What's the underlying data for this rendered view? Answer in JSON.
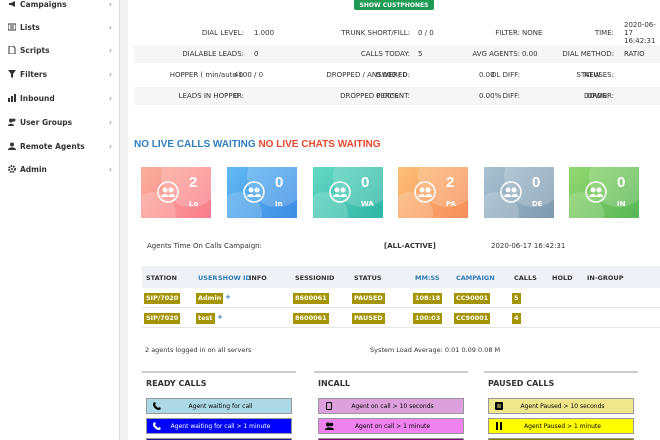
{
  "sidebar": {
    "items": [
      {
        "label": "Campaigns",
        "icon": "megaphone-icon"
      },
      {
        "label": "Lists",
        "icon": "list-icon"
      },
      {
        "label": "Scripts",
        "icon": "document-icon"
      },
      {
        "label": "Filters",
        "icon": "filter-icon"
      },
      {
        "label": "Inbound",
        "icon": "bar-chart-icon"
      },
      {
        "label": "User Groups",
        "icon": "users-icon"
      },
      {
        "label": "Remote Agents",
        "icon": "remote-agents-icon"
      },
      {
        "label": "Admin",
        "icon": "gear-icon"
      }
    ],
    "chevron": "‹"
  },
  "top_button": "SHOW CUSTPHONES",
  "stats": [
    [
      [
        "DIAL LEVEL:",
        "1.000"
      ],
      [
        "TRUNK SHORT/FILL:",
        "0 / 0"
      ],
      [
        "FILTER:",
        "NONE"
      ],
      [
        "TIME:",
        "2020-06-17 16:42:31"
      ]
    ],
    [
      [
        "DIALABLE LEADS:",
        "0"
      ],
      [
        "CALLS TODAY:",
        "5"
      ],
      [
        "AVG AGENTS:",
        "0.00"
      ],
      [
        "DIAL METHOD:",
        "RATIO"
      ]
    ],
    [
      [
        "HOPPER ( min/auto ):",
        "4000 / 0"
      ],
      [
        "DROPPED / ANSWERED:",
        "0.000 / 0"
      ],
      [
        "DL DIFF:",
        "0.00"
      ],
      [
        "STATUSES:",
        "NEW"
      ]
    ],
    [
      [
        "LEADS IN HOPPER:",
        "0"
      ],
      [
        "DROPPED PERCENT:",
        "0.00%"
      ],
      [
        "DIFF:",
        "0.00%"
      ],
      [
        "ORDER:",
        "DOWN"
      ]
    ]
  ],
  "waiting": {
    "calls": "NO LIVE CALLS WAITING",
    "chats": "NO LIVE CHATS WAITING",
    "calls_color": "#2f7ebd",
    "chats_color": "#e8492f"
  },
  "cards": [
    {
      "num": "2",
      "label": "Lo",
      "colors": [
        "#f7a39a",
        "#fc7a8e"
      ]
    },
    {
      "num": "0",
      "label": "In",
      "colors": [
        "#5fb6f0",
        "#3f8ee6"
      ]
    },
    {
      "num": "0",
      "label": "WA",
      "colors": [
        "#5fd5c0",
        "#2fb7a6"
      ]
    },
    {
      "num": "2",
      "label": "PA",
      "colors": [
        "#fbbd76",
        "#f7905c"
      ]
    },
    {
      "num": "0",
      "label": "DE",
      "colors": [
        "#a7c0d0",
        "#7f9bb0"
      ]
    },
    {
      "num": "0",
      "label": "IN",
      "colors": [
        "#8fd56c",
        "#5bb85a"
      ]
    }
  ],
  "agents_line": {
    "label": "Agents Time On Calls Campaign:",
    "campaign": "[ALL-ACTIVE]",
    "time": "2020-06-17 16:42:31"
  },
  "table": {
    "headers": {
      "station": "STATION",
      "user": "USER",
      "show_id": "SHOW ID",
      "info": "INFO",
      "session": "SESSIONID",
      "status": "STATUS",
      "mmss": "MM:SS",
      "campaign": "CAMPAIGN",
      "calls": "CALLS",
      "hold": "HOLD",
      "ingroup": "IN-GROUP"
    },
    "rows": [
      {
        "station": "SIP/7020",
        "user": "Admin",
        "plus": "+",
        "session": "8600061",
        "status": "PAUSED",
        "mmss": "108:18",
        "campaign": "CC90001",
        "calls": "5"
      },
      {
        "station": "SIP/7020",
        "user": "test",
        "plus": "+",
        "session": "8600061",
        "status": "PAUSED",
        "mmss": "100:03",
        "campaign": "CC90001",
        "calls": "4"
      }
    ]
  },
  "footer": {
    "agents": "2 agents logged in on all servers",
    "load": "System Load Average: 0.01 0.09 0.08   M"
  },
  "panels": [
    {
      "title": "READY CALLS",
      "items": [
        {
          "text": "Agent waiting for call",
          "bg": "#add8e6",
          "fg": "#000",
          "icon": "phone-icon"
        },
        {
          "text": "Agent waiting for call > 1 minute",
          "bg": "#0000ff",
          "fg": "#fff",
          "icon": "phone-icon"
        },
        {
          "text": "",
          "bg": "#1a1a8c",
          "fg": "#fff",
          "icon": ""
        }
      ]
    },
    {
      "title": "INCALL",
      "items": [
        {
          "text": "Agent on call > 10 seconds",
          "bg": "#dda0dd",
          "fg": "#000",
          "icon": "mobile-icon"
        },
        {
          "text": "Agent on call > 1 minute",
          "bg": "#ee82ee",
          "fg": "#000",
          "icon": "users-icon"
        },
        {
          "text": "",
          "bg": "#800080",
          "fg": "#fff",
          "icon": ""
        }
      ]
    },
    {
      "title": "PAUSED CALLS",
      "items": [
        {
          "text": "Agent Paused > 10 seconds",
          "bg": "#f0e68c",
          "fg": "#000",
          "icon": "pause-icon"
        },
        {
          "text": "Agent Paused > 1 minute",
          "bg": "#ffff00",
          "fg": "#000",
          "icon": "pause-icon"
        },
        {
          "text": "",
          "bg": "#808000",
          "fg": "#fff",
          "icon": ""
        }
      ]
    }
  ]
}
